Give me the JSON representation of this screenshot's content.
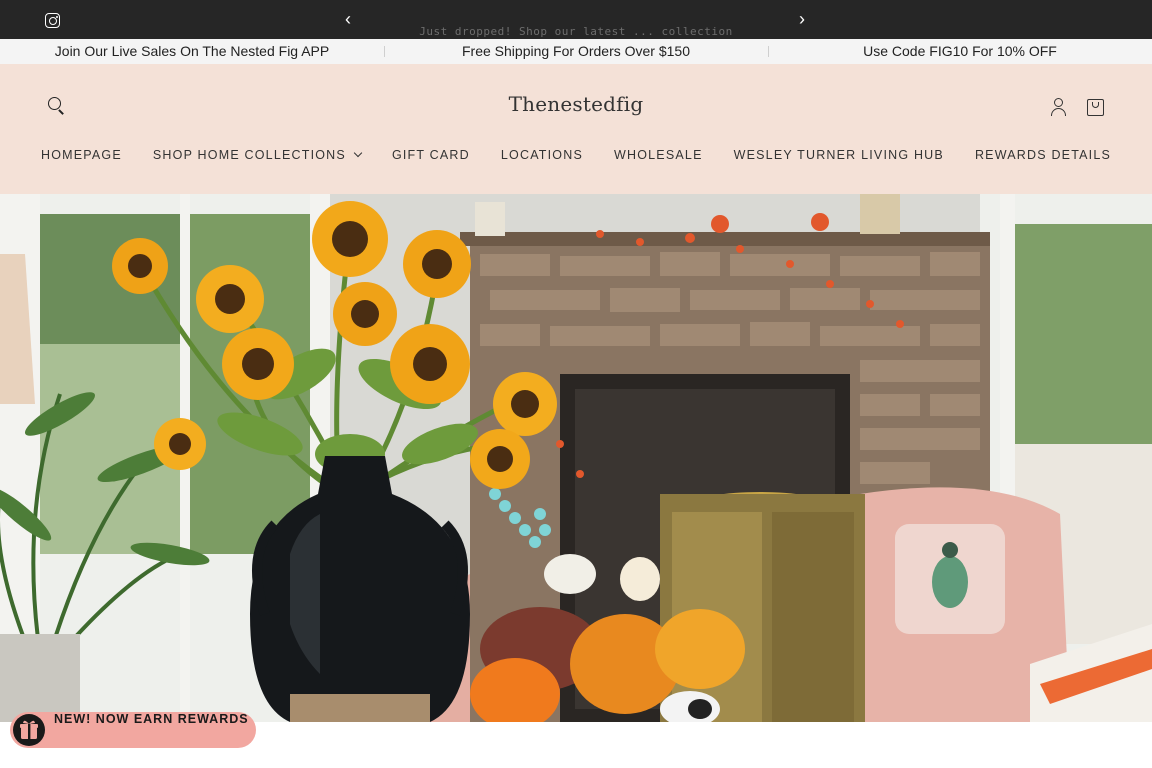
{
  "topbar": {
    "instagram_icon": "instagram-icon",
    "prev_icon": "chevron-left-icon",
    "next_icon": "chevron-right-icon",
    "prev_glyph": "‹",
    "next_glyph": "›",
    "announcement": "Just dropped! Shop our latest ... collection"
  },
  "promos": [
    "Join Our Live Sales On The Nested Fig APP",
    "Free Shipping For Orders Over $150",
    "Use Code FIG10 For 10% OFF"
  ],
  "header": {
    "logo": "Thenestedfig",
    "background": "#f4e1d7"
  },
  "nav": {
    "items": [
      "HOMEPAGE",
      "SHOP HOME COLLECTIONS",
      "GIFT CARD",
      "LOCATIONS",
      "WHOLESALE",
      "WESLEY TURNER LIVING HUB",
      "REWARDS DETAILS"
    ]
  },
  "rewards": {
    "label": "NEW! NOW EARN REWARDS",
    "icon": "gift-icon",
    "color": "#f2a7a0"
  }
}
